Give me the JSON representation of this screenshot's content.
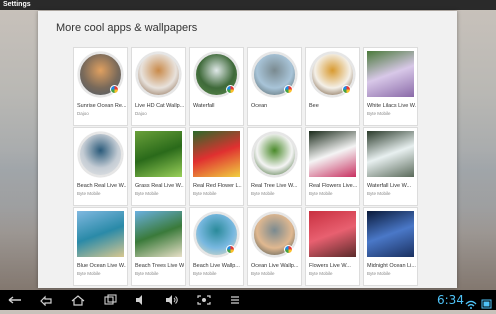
{
  "titlebar": {
    "title": "Settings"
  },
  "panel": {
    "heading": "More cool apps & wallpapers"
  },
  "cards": [
    {
      "title": "Sunrise Ocean Re...",
      "subtitle": "Dajoo",
      "shape": "circle",
      "badge": true,
      "colors": [
        "#7a6a5a",
        "#e0a060",
        "#4a5a6a"
      ]
    },
    {
      "title": "Live HD Cat Wallp...",
      "subtitle": "Dajoo",
      "shape": "circle",
      "badge": false,
      "colors": [
        "#e8e2dc",
        "#c98a4a",
        "#7d5a3c"
      ]
    },
    {
      "title": "Waterfall",
      "subtitle": "",
      "shape": "circle",
      "badge": true,
      "colors": [
        "#3f6a3a",
        "#dfe8e8",
        "#5a8a4a"
      ]
    },
    {
      "title": "Ocean",
      "subtitle": "",
      "shape": "circle",
      "badge": true,
      "colors": [
        "#a8c4d8",
        "#7a8a90",
        "#4a5a5a"
      ]
    },
    {
      "title": "Bee",
      "subtitle": "",
      "shape": "circle",
      "badge": true,
      "colors": [
        "#f4f0e8",
        "#d89a30",
        "#5a3a1a"
      ]
    },
    {
      "title": "White Lilacs Live W...",
      "subtitle": "Byte Mobile",
      "shape": "square",
      "badge": false,
      "colors": [
        "#4a7a3a",
        "#d8c8e8",
        "#8a6aa8"
      ]
    },
    {
      "title": "Beach Real Live W...",
      "subtitle": "Byte Mobile",
      "shape": "circle",
      "badge": false,
      "colors": [
        "#c4ccd4",
        "#2a5a7a",
        "#e8e8e8"
      ]
    },
    {
      "title": "Grass Real Live W...",
      "subtitle": "Byte Mobile",
      "shape": "square",
      "badge": false,
      "colors": [
        "#6aa03a",
        "#2a6a1a",
        "#9ad05a"
      ]
    },
    {
      "title": "Real Red Flower L...",
      "subtitle": "Byte Mobile",
      "shape": "square",
      "badge": false,
      "colors": [
        "#2a6a2a",
        "#e03030",
        "#f0d040"
      ]
    },
    {
      "title": "Real Tree Live W...",
      "subtitle": "Byte Mobile",
      "shape": "circle",
      "badge": false,
      "colors": [
        "#f4f4f4",
        "#4a8a2a",
        "#2a5a1a"
      ]
    },
    {
      "title": "Real Flowers Live...",
      "subtitle": "Byte Mobile",
      "shape": "square",
      "badge": false,
      "colors": [
        "#1a2a1a",
        "#f4f4f4",
        "#c83060"
      ]
    },
    {
      "title": "Waterfall Live W...",
      "subtitle": "Byte Mobile",
      "shape": "square",
      "badge": false,
      "colors": [
        "#2a3a2a",
        "#e8f0f0",
        "#5a6a5a"
      ]
    },
    {
      "title": "Blue Ocean Live W...",
      "subtitle": "Byte Mobile",
      "shape": "square",
      "badge": false,
      "colors": [
        "#80b8e0",
        "#2a8aa8",
        "#d8c890"
      ]
    },
    {
      "title": "Beach Trees Live W...",
      "subtitle": "Byte Mobile",
      "shape": "square",
      "badge": false,
      "colors": [
        "#6ab0e0",
        "#3a7a3a",
        "#e8e0c8"
      ]
    },
    {
      "title": "Beach Live Wallp...",
      "subtitle": "Byte Mobile",
      "shape": "circle",
      "badge": true,
      "colors": [
        "#78b8e0",
        "#2a8a9a",
        "#e8e0c0"
      ]
    },
    {
      "title": "Ocean Live Wallp...",
      "subtitle": "Byte Mobile",
      "shape": "circle",
      "badge": true,
      "colors": [
        "#e0b890",
        "#7a8a90",
        "#3a4a4a"
      ]
    },
    {
      "title": "Flowers Live W...",
      "subtitle": "Byte Mobile",
      "shape": "square",
      "badge": false,
      "colors": [
        "#c83040",
        "#e86070",
        "#5a2a2a"
      ]
    },
    {
      "title": "Midnight Ocean Li...",
      "subtitle": "Byte Mobile",
      "shape": "square",
      "badge": false,
      "colors": [
        "#0a1a3a",
        "#4a78c8",
        "#1a3060"
      ]
    }
  ],
  "navbar": {
    "back_icon": "back-icon",
    "home_icon": "home-icon",
    "recents_icon": "recents-icon",
    "volume_down_icon": "volume-down-icon",
    "volume_up_icon": "volume-up-icon",
    "screenshot_icon": "screenshot-icon",
    "menu_icon": "menu-icon",
    "clock": "6:34"
  }
}
